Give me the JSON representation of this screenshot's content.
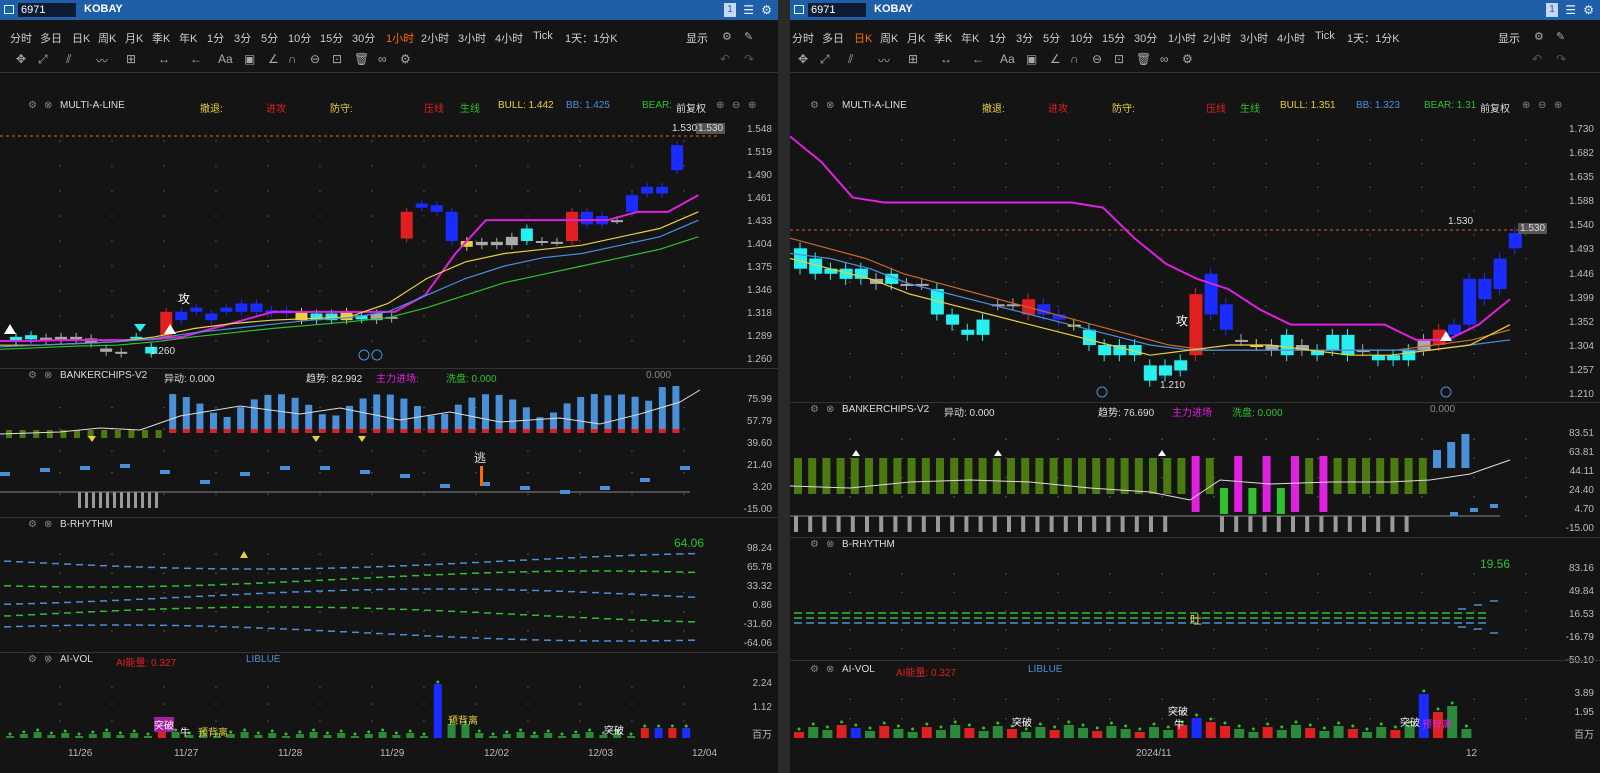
{
  "left": {
    "symbol": "6971",
    "name": "KOBAY",
    "badge": "1",
    "periods": [
      "分时",
      "多日",
      "日K",
      "周K",
      "月K",
      "季K",
      "年K",
      "1分",
      "3分",
      "5分",
      "10分",
      "15分",
      "30分",
      "1小时",
      "2小时",
      "3小时",
      "4小时",
      "Tick",
      "1天：1分K"
    ],
    "active_period": "1小时",
    "show_label": "显示",
    "main": {
      "indicator": "MULTI-A-LINE",
      "trend_label": "撤退:",
      "attack_label": "进攻",
      "defend_label": "防守:",
      "red_label": "压线",
      "green_label": "生线",
      "bull": "BULL: 1.442",
      "bb": "BB: 1.425",
      "bear": "BEAR:",
      "adjust": "前复权",
      "price_tag": "1.530",
      "price_axis_tag": "1.530",
      "low_label": "1.260",
      "axis": [
        "1.548",
        "1.519",
        "1.490",
        "1.461",
        "1.433",
        "1.404",
        "1.375",
        "1.346",
        "1.318",
        "1.289",
        "1.260"
      ],
      "attack_marker": "攻"
    },
    "bankerchips": {
      "name": "BANKERCHIPS-V2",
      "anomaly": "异动: 0.000",
      "trend": "趋势: 82.992",
      "main_in": "主力进场:",
      "wash": "洗盘: 0.000",
      "value_right": "0.000",
      "escape_marker": "逃",
      "axis": [
        "75.99",
        "57.79",
        "39.60",
        "21.40",
        "3.20",
        "-15.00"
      ]
    },
    "rhythm": {
      "name": "B-RHYTHM",
      "value": "64.06",
      "axis": [
        "98.24",
        "65.78",
        "33.32",
        "0.86",
        "-31.60",
        "-64.06"
      ]
    },
    "aivol": {
      "name": "AI-VOL",
      "energy": "AI能量: 0.327",
      "blue_label": "LIBLUE",
      "axis": [
        "2.24",
        "1.12",
        "百万"
      ],
      "annotations": [
        "突破",
        "牛",
        "预背离",
        "预背离",
        "突破"
      ]
    },
    "dates": [
      "11/26",
      "11/27",
      "11/28",
      "11/29",
      "12/02",
      "12/03",
      "12/04"
    ]
  },
  "right": {
    "symbol": "6971",
    "name": "KOBAY",
    "badge": "1",
    "periods": [
      "分时",
      "多日",
      "日K",
      "周K",
      "月K",
      "季K",
      "年K",
      "1分",
      "3分",
      "5分",
      "10分",
      "15分",
      "30分",
      "1小时",
      "2小时",
      "3小时",
      "4小时",
      "Tick",
      "1天：1分K"
    ],
    "active_period": "日K",
    "show_label": "显示",
    "main": {
      "indicator": "MULTI-A-LINE",
      "trend_label": "撤退:",
      "attack_label": "进攻",
      "defend_label": "防守:",
      "red_label": "压线",
      "green_label": "生线",
      "bull": "BULL: 1.351",
      "bb": "BB: 1.323",
      "bear": "BEAR: 1.31",
      "adjust": "前复权",
      "price_tag": "1.530",
      "price_axis_tag": "1.530",
      "low_label": "1.210",
      "axis": [
        "1.730",
        "1.682",
        "1.635",
        "1.588",
        "1.540",
        "1.493",
        "1.446",
        "1.399",
        "1.352",
        "1.304",
        "1.257",
        "1.210"
      ],
      "attack_marker": "攻"
    },
    "bankerchips": {
      "name": "BANKERCHIPS-V2",
      "anomaly": "异动: 0.000",
      "trend": "趋势: 76.690",
      "main_in": "主力进场",
      "wash": "洗盘: 0.000",
      "value_right": "0.000",
      "axis": [
        "83.51",
        "63.81",
        "44.11",
        "24.40",
        "4.70",
        "-15.00"
      ]
    },
    "rhythm": {
      "name": "B-RHYTHM",
      "value": "19.56",
      "axis": [
        "83.16",
        "49.84",
        "16.53",
        "-16.79",
        "-50.10"
      ],
      "marker": "吐"
    },
    "aivol": {
      "name": "AI-VOL",
      "energy": "AI能量: 0.327",
      "blue_label": "LIBLUE",
      "axis": [
        "3.89",
        "1.95",
        "百万"
      ],
      "annotations": [
        "突破",
        "突破",
        "牛",
        "突破",
        "预背离"
      ]
    },
    "dates": [
      "2024/11",
      "12"
    ]
  },
  "colors": {
    "titlebar": "#1f5fa8",
    "bg": "#141414",
    "red": "#e02020",
    "cyan": "#26f0f0",
    "blue": "#1a2cff",
    "magenta": "#e020e0",
    "yellow": "#e8d040",
    "green": "#30c030",
    "steel": "#4a90d9"
  }
}
